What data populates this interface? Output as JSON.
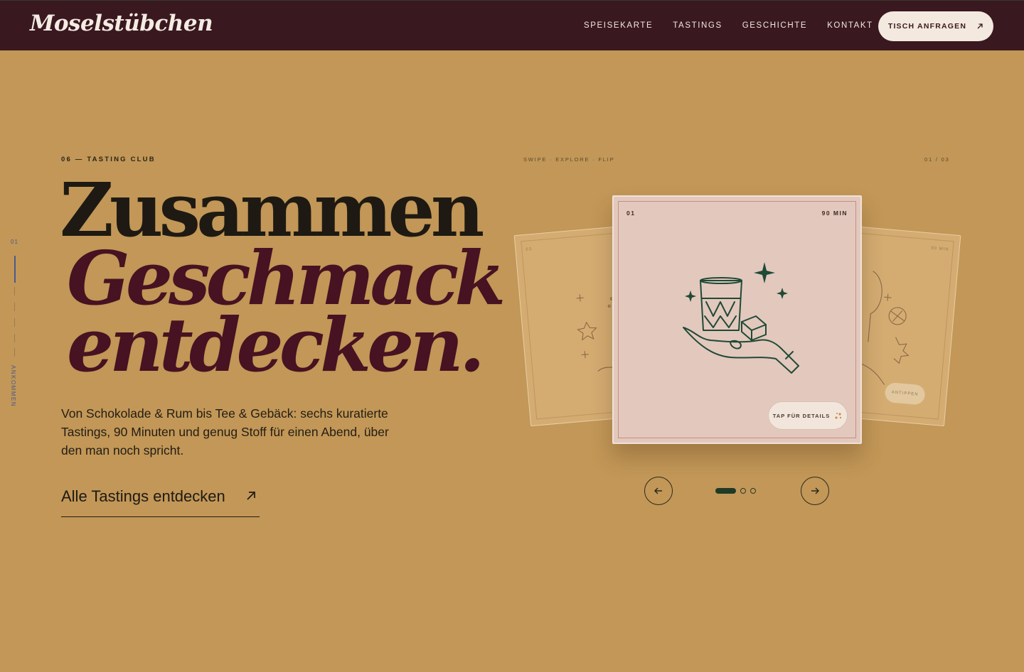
{
  "header": {
    "logo": "Moselstübchen",
    "nav": [
      "SPEISEKARTE",
      "TASTINGS",
      "GESCHICHTE",
      "KONTAKT"
    ],
    "cta": "TISCH ANFRAGEN"
  },
  "sidebar": {
    "index": "01",
    "label": "ANKOMMEN"
  },
  "hero": {
    "eyebrow": "06 — TASTING CLUB",
    "line1": "Zusammen",
    "line2": "Geschmack",
    "line3": "entdecken.",
    "lead": "Von Schokolade & Rum bis Tee & Gebäck: sechs kuratierte Tastings, 90 Minuten und genug Stoff für einen Abend, über den man noch spricht.",
    "link": "Alle Tastings entdecken"
  },
  "carousel": {
    "hint": "SWIPE · EXPLORE · FLIP",
    "counter": "01 / 03",
    "main_card": {
      "number": "01",
      "duration": "90 MIN",
      "tap": "TAP FÜR DETAILS"
    },
    "left_card": {
      "number": "03"
    },
    "right_card": {
      "duration": "90 MIN",
      "badge": "ANTIPPEN"
    },
    "active_index": 0,
    "total": 3
  },
  "colors": {
    "background": "#c29757",
    "header": "#3a1820",
    "accent_wine": "#471221",
    "illustration_green": "#1f4a36"
  }
}
